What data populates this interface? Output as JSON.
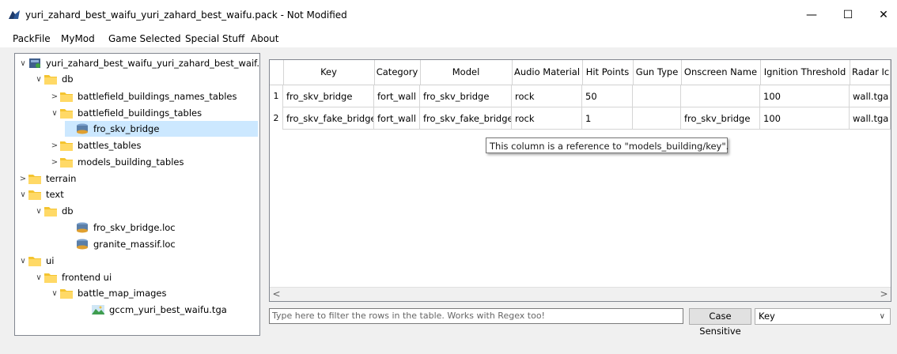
{
  "window": {
    "title": "yuri_zahard_best_waifu_yuri_zahard_best_waifu.pack - Not Modified",
    "minimize": "—",
    "maximize": "☐",
    "close": "✕"
  },
  "menu": [
    "PackFile",
    "MyMod",
    "Game Selected",
    "Special Stuff",
    "About"
  ],
  "tree": [
    {
      "label": "yuri_zahard_best_waifu_yuri_zahard_best_waif...",
      "icon": "pack-icon",
      "arrow": "∨"
    },
    {
      "label": "db",
      "icon": "folder-icon",
      "arrow": "∨"
    },
    {
      "label": "battlefield_buildings_names_tables",
      "icon": "folder-icon",
      "arrow": ">"
    },
    {
      "label": "battlefield_buildings_tables",
      "icon": "folder-icon",
      "arrow": "∨"
    },
    {
      "label": "fro_skv_bridge",
      "icon": "db-icon",
      "arrow": ""
    },
    {
      "label": "battles_tables",
      "icon": "folder-icon",
      "arrow": ">"
    },
    {
      "label": "models_building_tables",
      "icon": "folder-icon",
      "arrow": ">"
    },
    {
      "label": "terrain",
      "icon": "folder-icon",
      "arrow": ">"
    },
    {
      "label": "text",
      "icon": "folder-icon",
      "arrow": "∨"
    },
    {
      "label": "db",
      "icon": "folder-icon",
      "arrow": "∨"
    },
    {
      "label": "fro_skv_bridge.loc",
      "icon": "db-icon",
      "arrow": ""
    },
    {
      "label": "granite_massif.loc",
      "icon": "db-icon",
      "arrow": ""
    },
    {
      "label": "ui",
      "icon": "folder-icon",
      "arrow": "∨"
    },
    {
      "label": "frontend ui",
      "icon": "folder-icon",
      "arrow": "∨"
    },
    {
      "label": "battle_map_images",
      "icon": "folder-icon",
      "arrow": "∨"
    },
    {
      "label": "gccm_yuri_best_waifu.tga",
      "icon": "image-icon",
      "arrow": ""
    }
  ],
  "table": {
    "headers": [
      "Key",
      "Category",
      "Model",
      "Audio Material",
      "Hit Points",
      "Gun Type",
      "Onscreen Name",
      "Ignition Threshold",
      "Radar Ic"
    ],
    "rows": [
      {
        "num": "1",
        "cells": [
          "fro_skv_bridge",
          "fort_wall",
          "fro_skv_bridge",
          "rock",
          "50",
          "",
          "",
          "100",
          "wall.tga"
        ]
      },
      {
        "num": "2",
        "cells": [
          "fro_skv_fake_bridge",
          "fort_wall",
          "fro_skv_fake_bridge",
          "rock",
          "1",
          "",
          "fro_skv_bridge",
          "100",
          "wall.tga"
        ]
      }
    ],
    "scroll_left": "<",
    "scroll_right": ">"
  },
  "tooltip": "This column is a reference to \"models_building/key\".",
  "filter": {
    "placeholder": "Type here to filter the rows in the table. Works with Regex too!",
    "case_button": "Case Sensitive",
    "column_selected": "Key",
    "chevron": "∨"
  },
  "colors": {
    "folder": "#f4c430",
    "selection": "#cce8ff",
    "db": "#5b7fa8"
  }
}
